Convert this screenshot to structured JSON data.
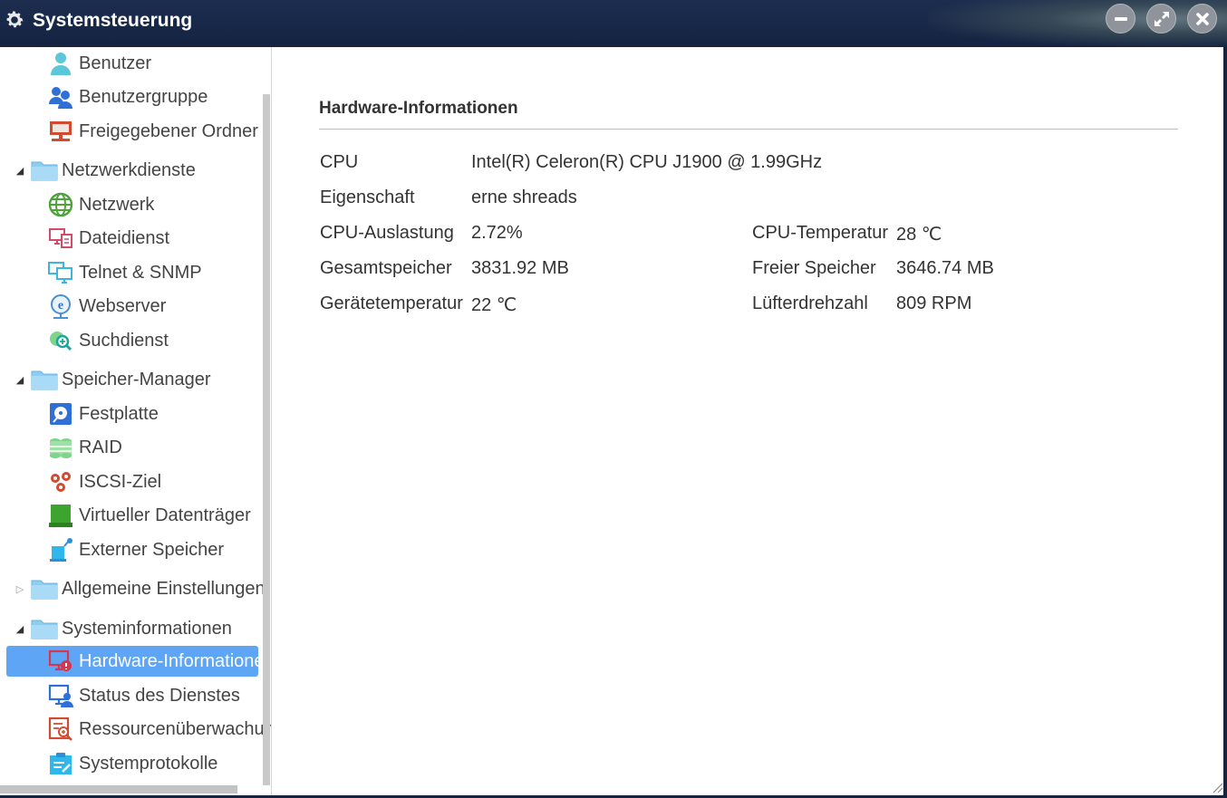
{
  "window": {
    "title": "Systemsteuerung"
  },
  "sidebar": {
    "items": [
      {
        "type": "child",
        "label": "Benutzer",
        "icon": "user-icon"
      },
      {
        "type": "child",
        "label": "Benutzergruppe",
        "icon": "user-group-icon"
      },
      {
        "type": "child",
        "label": "Freigegebener Ordner",
        "icon": "shared-folder-icon"
      },
      {
        "type": "group",
        "label": "Netzwerkdienste",
        "icon": "folder-icon",
        "expanded": true
      },
      {
        "type": "child",
        "label": "Netzwerk",
        "icon": "globe-icon"
      },
      {
        "type": "child",
        "label": "Dateidienst",
        "icon": "file-service-icon"
      },
      {
        "type": "child",
        "label": "Telnet & SNMP",
        "icon": "monitor-icon"
      },
      {
        "type": "child",
        "label": "Webserver",
        "icon": "webserver-icon"
      },
      {
        "type": "child",
        "label": "Suchdienst",
        "icon": "search-service-icon"
      },
      {
        "type": "group",
        "label": "Speicher-Manager",
        "icon": "folder-icon",
        "expanded": true
      },
      {
        "type": "child",
        "label": "Festplatte",
        "icon": "hard-disk-icon"
      },
      {
        "type": "child",
        "label": "RAID",
        "icon": "raid-icon"
      },
      {
        "type": "child",
        "label": "ISCSI-Ziel",
        "icon": "iscsi-icon"
      },
      {
        "type": "child",
        "label": "Virtueller Datenträger",
        "icon": "virtual-disk-icon"
      },
      {
        "type": "child",
        "label": "Externer Speicher",
        "icon": "external-storage-icon"
      },
      {
        "type": "group",
        "label": "Allgemeine Einstellungen",
        "icon": "folder-icon",
        "expanded": false
      },
      {
        "type": "group",
        "label": "Systeminformationen",
        "icon": "folder-icon",
        "expanded": true
      },
      {
        "type": "child",
        "label": "Hardware-Informationen",
        "icon": "hardware-info-icon",
        "selected": true
      },
      {
        "type": "child",
        "label": "Status des Dienstes",
        "icon": "service-status-icon"
      },
      {
        "type": "child",
        "label": "Ressourcenüberwachung",
        "icon": "resource-monitor-icon"
      },
      {
        "type": "child",
        "label": "Systemprotokolle",
        "icon": "system-log-icon"
      }
    ]
  },
  "main": {
    "title": "Hardware-Informationen",
    "rows": [
      {
        "label": "CPU",
        "value": "Intel(R) Celeron(R) CPU J1900 @ 1.99GHz"
      },
      {
        "label": "Eigenschaft",
        "value": "erne shreads"
      },
      {
        "label": "CPU-Auslastung",
        "value": "2.72%",
        "label2": "CPU-Temperatur",
        "value2": "28 ℃"
      },
      {
        "label": "Gesamtspeicher",
        "value": "3831.92 MB",
        "label2": "Freier Speicher",
        "value2": "3646.74 MB"
      },
      {
        "label": "Gerätetemperatur",
        "value": "22 ℃",
        "label2": "Lüfterdrehzahl",
        "value2": "809 RPM"
      }
    ]
  },
  "colors": {
    "titlebar": "#16243f",
    "selected": "#5fa5f5",
    "folder": "#8ccdf2"
  }
}
